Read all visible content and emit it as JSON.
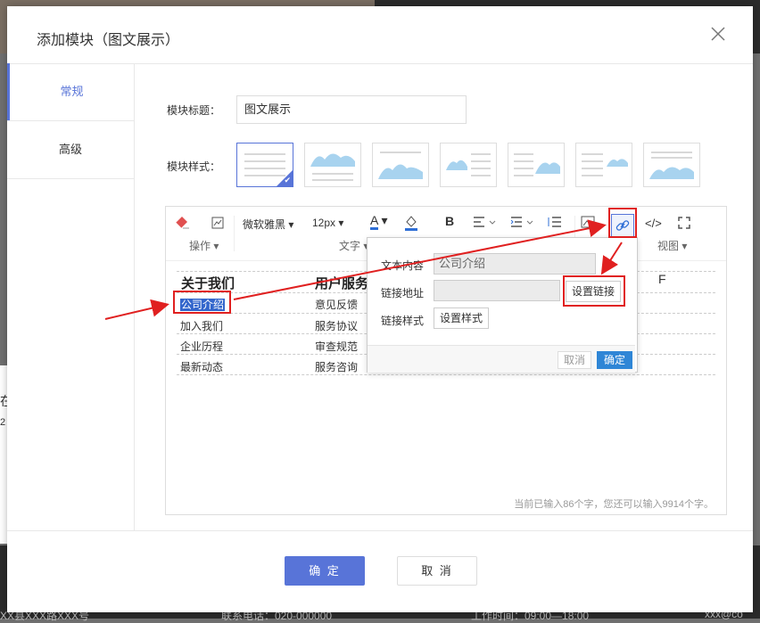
{
  "background": {
    "bottom_text": [
      "XX县XXX路XXX号",
      "联系电话：020-000000",
      "工作时间：09:00—18:00",
      "xxx@co"
    ],
    "side_text": [
      "在",
      "2"
    ]
  },
  "dialog": {
    "title": "添加模块（图文展示）",
    "tabs": [
      {
        "label": "常规"
      },
      {
        "label": "高级"
      }
    ],
    "fields": {
      "title_label": "模块标题：",
      "title_value": "图文展示",
      "style_label": "模块样式："
    },
    "toolbar": {
      "font_family": "微软雅黑",
      "font_size": "12px",
      "groups": {
        "ops": "操作",
        "text": "文字",
        "view": "视图"
      }
    },
    "content": {
      "col1_head": "关于我们",
      "col2_head": "用户服务",
      "col3_head_tail": "F",
      "col1": [
        "公司介绍",
        "加入我们",
        "企业历程",
        "最新动态"
      ],
      "col2": [
        "意见反馈",
        "服务协议",
        "审查规范",
        "服务咨询"
      ]
    },
    "status": "当前已输入86个字，您还可以输入9914个字。",
    "link_popup": {
      "text_label": "文本内容",
      "text_value": "公司介绍",
      "url_label": "链接地址",
      "url_value": "",
      "set_link": "设置链接",
      "style_label": "链接样式",
      "set_style": "设置样式",
      "cancel": "取消",
      "ok": "确定"
    },
    "buttons": {
      "ok": "确 定",
      "cancel": "取 消"
    },
    "colors": {
      "accent": "#5874d8",
      "annotation": "#e02020",
      "selection": "#3366cc",
      "popup_ok": "#2f86d6"
    }
  }
}
